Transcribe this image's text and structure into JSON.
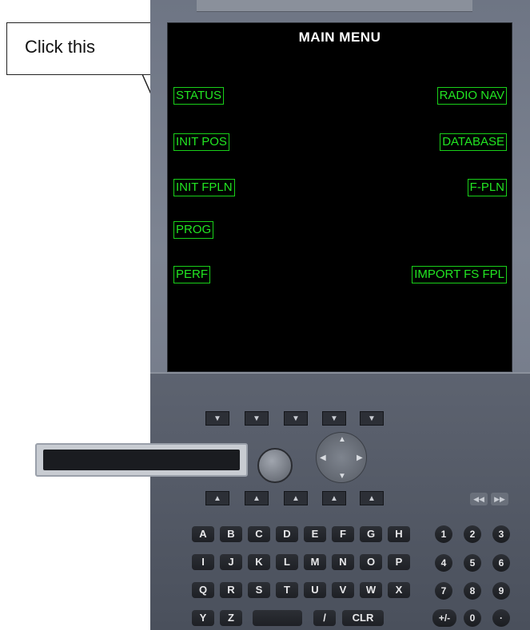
{
  "callout": {
    "text": "Click this"
  },
  "screen": {
    "title": "MAIN MENU",
    "left_items": [
      "STATUS",
      "INIT POS",
      "INIT FPLN",
      "PROG",
      "PERF"
    ],
    "right_items": [
      "RADIO NAV",
      "DATABASE",
      "F-PLN",
      "IMPORT FS FPL"
    ],
    "text_color": "#22e622",
    "background": "#000000"
  },
  "keypad": {
    "upper_softkeys": [
      "▼",
      "▼",
      "▼",
      "▼",
      "▼"
    ],
    "lower_softkeys": [
      "▲",
      "▲",
      "▲",
      "▲",
      "▲"
    ],
    "nav_arrows": {
      "up": "▲",
      "down": "▼",
      "left": "◀",
      "right": "▶"
    },
    "ff_buttons": [
      "◀◀",
      "▶▶"
    ],
    "row1": [
      "A",
      "B",
      "C",
      "D",
      "E",
      "F",
      "G",
      "H"
    ],
    "row2": [
      "I",
      "J",
      "K",
      "L",
      "M",
      "N",
      "O",
      "P"
    ],
    "row3": [
      "Q",
      "R",
      "S",
      "T",
      "U",
      "V",
      "W",
      "X"
    ],
    "row4": [
      "Y",
      "Z",
      "",
      "/",
      "CLR"
    ],
    "num_row1": [
      "1",
      "2",
      "3"
    ],
    "num_row2": [
      "4",
      "5",
      "6"
    ],
    "num_row3": [
      "7",
      "8",
      "9"
    ],
    "num_row4": [
      "+/-",
      "0",
      "·"
    ]
  }
}
